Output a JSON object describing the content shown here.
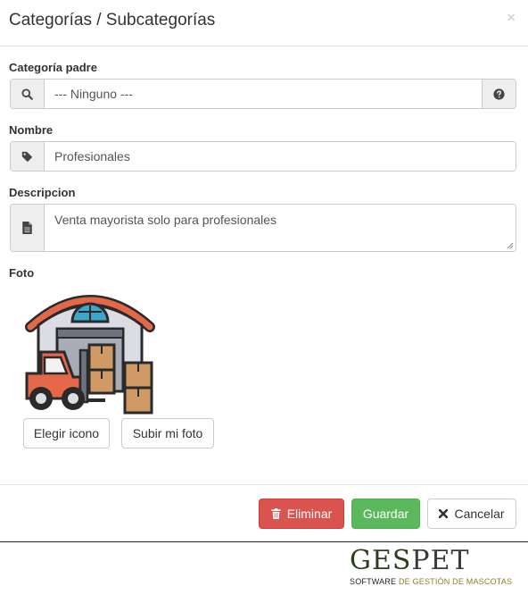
{
  "dialog": {
    "title": "Categorías / Subcategorías",
    "close_symbol": "×"
  },
  "fields": {
    "parent_category": {
      "label": "Categoría padre",
      "value": "--- Ninguno ---",
      "left_icon": "search-icon",
      "right_icon": "question-circle-icon"
    },
    "name": {
      "label": "Nombre",
      "value": "Profesionales",
      "icon": "tag-icon"
    },
    "description": {
      "label": "Descripcion",
      "value": "Venta mayorista solo para profesionales",
      "icon": "file-text-icon"
    },
    "photo": {
      "label": "Foto",
      "image": "warehouse-forklift-icon"
    }
  },
  "photo_buttons": {
    "choose_icon": "Elegir icono",
    "upload_photo": "Subir mi foto"
  },
  "footer": {
    "delete": "Eliminar",
    "save": "Guardar",
    "cancel": "Cancelar"
  },
  "brand": {
    "name_part1": "GES",
    "name_part2": "PET",
    "tagline_part1": "SOFTWARE ",
    "tagline_part2": "DE GESTIÓN DE MASCOTAS"
  },
  "colors": {
    "danger": "#d9534f",
    "success": "#5cb85c",
    "brand_green": "#2c3f1c",
    "brand_gold": "#8a7f2a"
  }
}
